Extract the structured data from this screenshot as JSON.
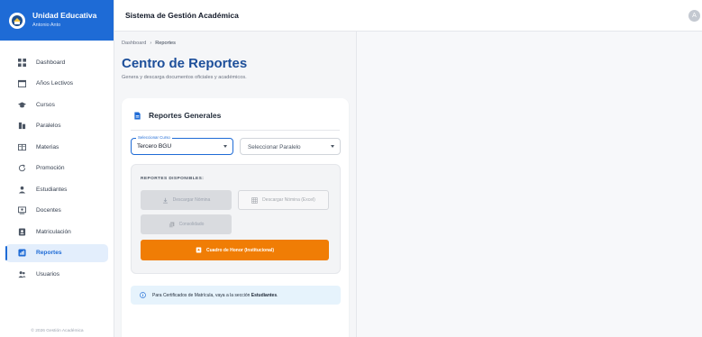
{
  "brand": {
    "title": "Unidad Educativa",
    "user": "Antonio Anto"
  },
  "topbar": {
    "title": "Sistema de Gestión Académica",
    "avatar_initial": "A"
  },
  "sidebar": {
    "items": [
      {
        "label": "Dashboard",
        "icon": "dashboard-icon"
      },
      {
        "label": "Años Lectivos",
        "icon": "calendar-icon"
      },
      {
        "label": "Cursos",
        "icon": "graduation-cap-icon"
      },
      {
        "label": "Paralelos",
        "icon": "columns-icon"
      },
      {
        "label": "Materias",
        "icon": "book-icon"
      },
      {
        "label": "Promoción",
        "icon": "refresh-icon"
      },
      {
        "label": "Estudiantes",
        "icon": "person-icon"
      },
      {
        "label": "Docentes",
        "icon": "teacher-icon"
      },
      {
        "label": "Matriculación",
        "icon": "badge-icon"
      },
      {
        "label": "Reportes",
        "icon": "report-icon",
        "active": true
      },
      {
        "label": "Usuarios",
        "icon": "users-icon"
      }
    ],
    "footer": "© 2026 Gestión Académica"
  },
  "breadcrumb": {
    "root": "Dashboard",
    "separator": "›",
    "current": "Reportes"
  },
  "page": {
    "title": "Centro de Reportes",
    "subtitle": "Genera y descarga documentos oficiales y académicos."
  },
  "card": {
    "title": "Reportes Generales",
    "curso": {
      "legend": "Seleccionar Curso",
      "value": "Tercero BGU"
    },
    "paralelo": {
      "placeholder": "Seleccionar Paralelo"
    },
    "reports_label": "REPORTES DISPONIBLES:",
    "buttons": {
      "nomina": "Descargar Nómina",
      "excel": "Descargar Nómina (Excel)",
      "consolidado": "Consolidado",
      "honor": "Cuadro de Honor (Institucional)"
    },
    "info": {
      "text": "Para Certificados de Matrícula, vaya a la sección",
      "link": "Estudiantes",
      "end": "."
    }
  },
  "colors": {
    "primary": "#1e6bd6",
    "accent": "#f07d05",
    "title": "#1d4f9a",
    "info_bg": "#e6f3fc"
  }
}
